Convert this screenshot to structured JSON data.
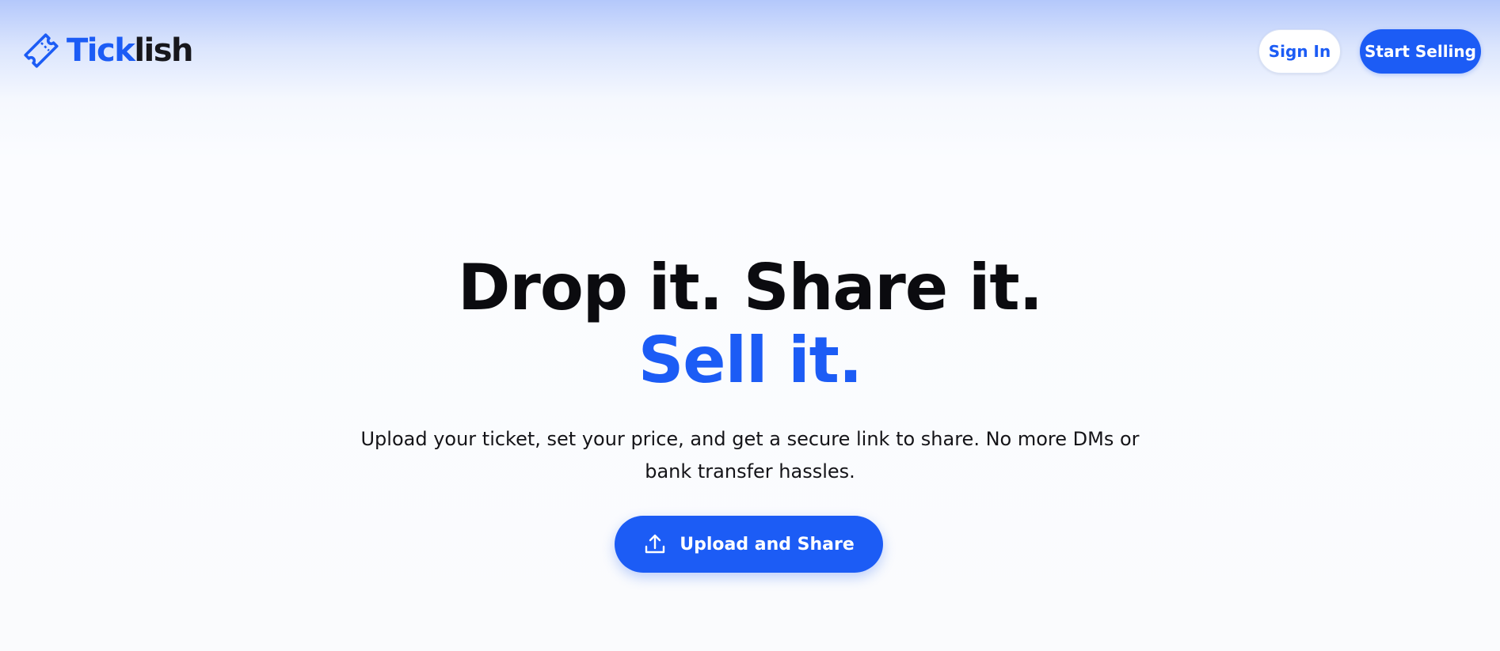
{
  "brand": {
    "name_part_1": "Tick",
    "name_part_2": "lish",
    "logo_icon": "ticket-icon",
    "accent_color": "#1c5cf5"
  },
  "nav": {
    "sign_in_label": "Sign In",
    "start_selling_label": "Start Selling"
  },
  "hero": {
    "headline_line_1": "Drop it. Share it.",
    "headline_line_2": "Sell it.",
    "subtitle": "Upload your ticket, set your price, and get a secure link to share. No more DMs or bank transfer hassles.",
    "cta_label": "Upload and Share",
    "cta_icon": "upload-icon"
  }
}
